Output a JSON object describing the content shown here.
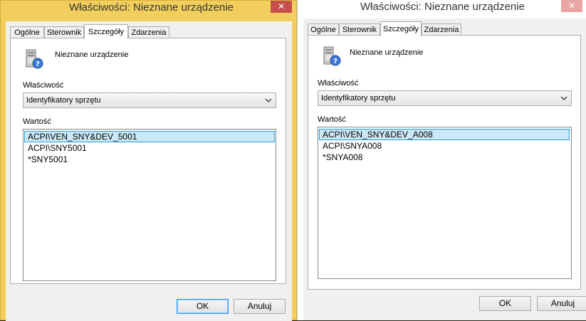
{
  "windows": {
    "left": {
      "title": "Właściwości: Nieznane urządzenie",
      "close_glyph": "✕",
      "tabs": [
        "Ogólne",
        "Sterownik",
        "Szczegóły",
        "Zdarzenia"
      ],
      "active_tab": "Szczegóły",
      "device_name": "Nieznane urządzenie",
      "property_label": "Właściwość",
      "property_value": "Identyfikatory sprzętu",
      "value_label": "Wartość",
      "values": [
        "ACPI\\VEN_SNY&DEV_5001",
        "ACPI\\SNY5001",
        "*SNY5001"
      ],
      "selected_index": 0,
      "ok_label": "OK",
      "cancel_label": "Anuluj"
    },
    "right": {
      "title": "Właściwości: Nieznane urządzenie",
      "close_glyph": "✕",
      "tabs": [
        "Ogólne",
        "Sterownik",
        "Szczegóły",
        "Zdarzenia"
      ],
      "active_tab": "Szczegóły",
      "device_name": "Nieznane urządzenie",
      "property_label": "Właściwość",
      "property_value": "Identyfikatory sprzętu",
      "value_label": "Wartość",
      "values": [
        "ACPI\\VEN_SNY&DEV_A008",
        "ACPI\\SNYA008",
        "*SNYA008"
      ],
      "selected_index": 0,
      "ok_label": "OK",
      "cancel_label": "Anuluj"
    }
  },
  "colors": {
    "left_frame": "#f2cf5c",
    "right_frame": "#ffffff",
    "close_button": "#c7504c",
    "selection_fill": "#cce8f6",
    "selection_border": "#26a0da"
  }
}
